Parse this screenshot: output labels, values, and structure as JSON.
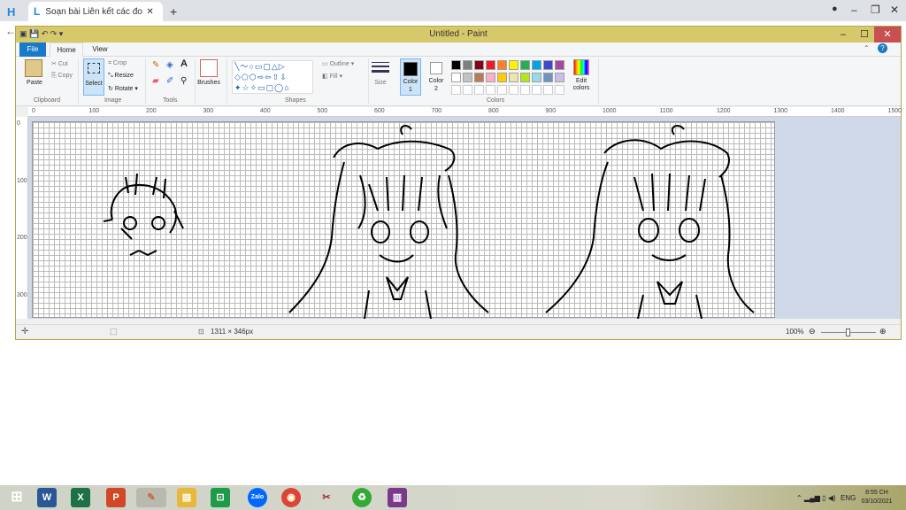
{
  "browser": {
    "tab1_title": "Soạn bài Liên kết các đoạn văn tr",
    "new_tab": "+",
    "min": "–",
    "max": "❐",
    "close": "✕"
  },
  "paint": {
    "title": "Untitled - Paint",
    "min": "–",
    "max": "☐",
    "close": "✕"
  },
  "ribbon": {
    "tabs": [
      "File",
      "Home",
      "View"
    ],
    "clipboard": {
      "paste": "Paste",
      "cut": "Cut",
      "copy": "Copy",
      "label": "Clipboard"
    },
    "image": {
      "select": "Select",
      "crop": "Crop",
      "resize": "Resize",
      "rotate": "Rotate",
      "label": "Image"
    },
    "tools": {
      "label": "Tools"
    },
    "brushes": "Brushes",
    "shapes": {
      "outline": "Outline",
      "fill": "Fill",
      "label": "Shapes"
    },
    "size": "Size",
    "color1": "Color\n1",
    "color1_a": "Color",
    "color1_b": "1",
    "color2_a": "Color",
    "color2_b": "2",
    "colors_label": "Colors",
    "edit_colors_a": "Edit",
    "edit_colors_b": "colors",
    "palette_row1": [
      "#000000",
      "#7f7f7f",
      "#880015",
      "#ed1c24",
      "#ff7f27",
      "#fff200",
      "#22b14c",
      "#00a2e8",
      "#3f48cc",
      "#a349a4"
    ],
    "palette_row2": [
      "#ffffff",
      "#c3c3c3",
      "#b97a57",
      "#ffaec9",
      "#ffc90e",
      "#efe4b0",
      "#b5e61d",
      "#99d9ea",
      "#7092be",
      "#c8bfe7"
    ]
  },
  "ruler_h": [
    "0",
    "100",
    "200",
    "300",
    "400",
    "500",
    "600",
    "700",
    "800",
    "900",
    "1000",
    "1100",
    "1200",
    "1300",
    "1400",
    "1500"
  ],
  "ruler_v": [
    "0",
    "100",
    "200",
    "300"
  ],
  "status": {
    "size": "1311 × 346px",
    "zoom": "100%"
  },
  "taskbar": {
    "lang": "ENG",
    "time": "8:55 CH",
    "date": "03/10/2021"
  }
}
